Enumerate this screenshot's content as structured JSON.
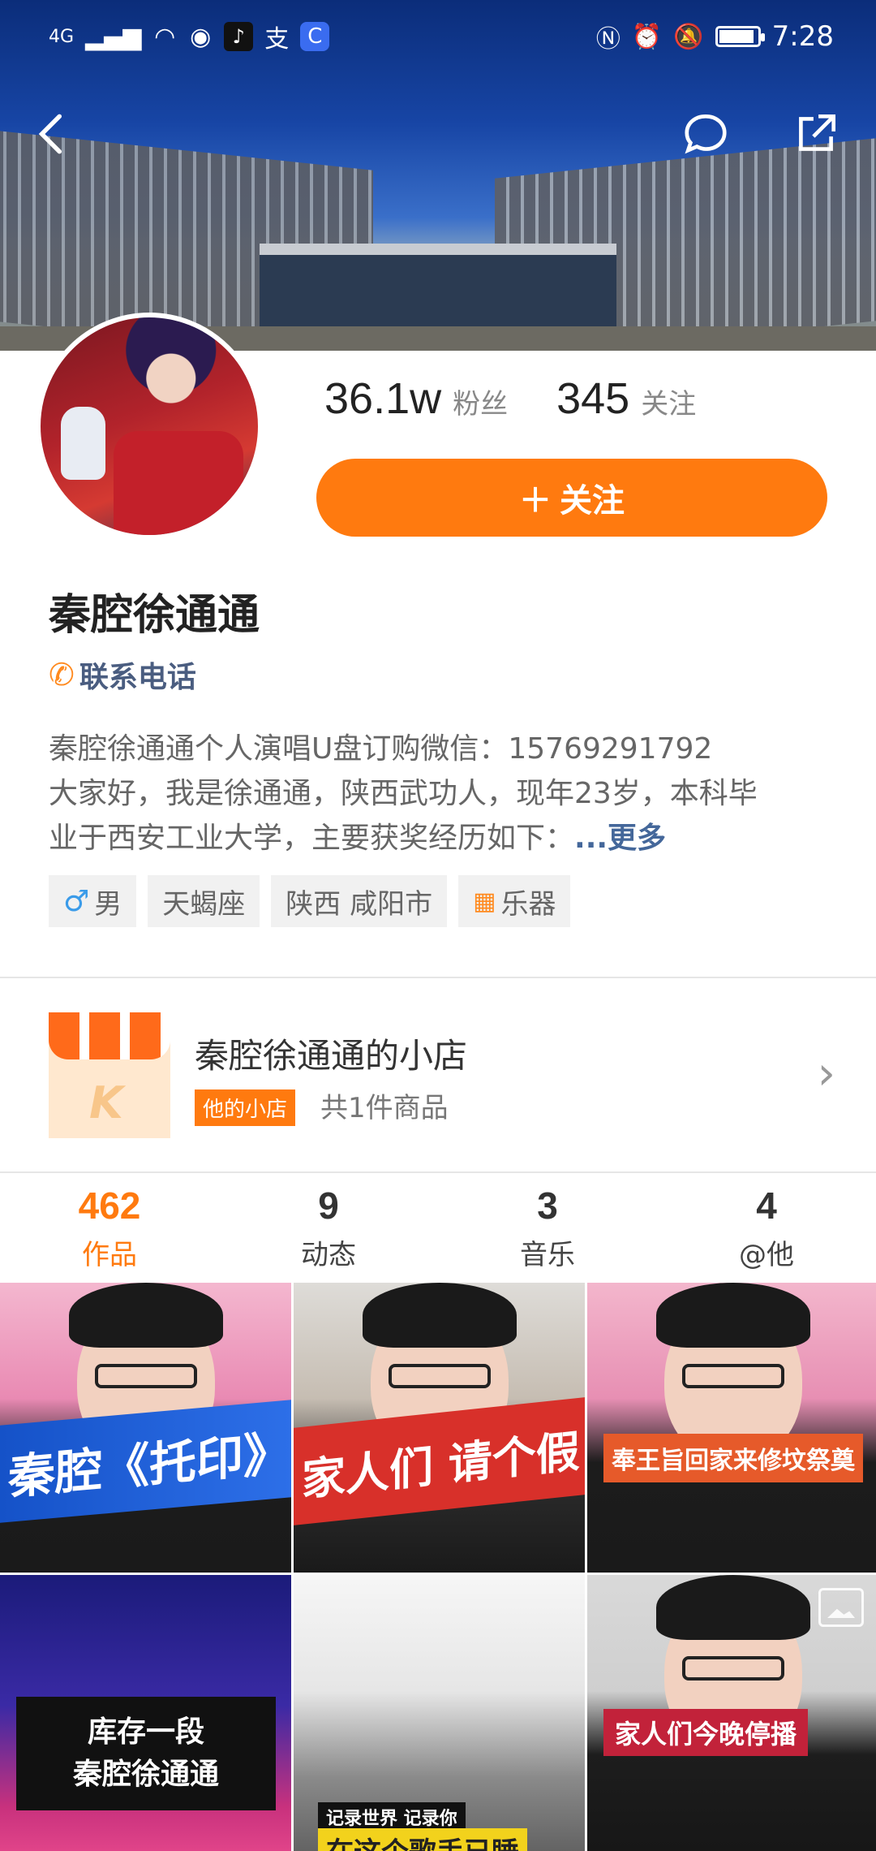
{
  "status_bar": {
    "network": "4G",
    "time": "7:28",
    "battery_level": 0.85
  },
  "profile": {
    "name": "秦腔徐通通",
    "contact_label": "联系电话",
    "followers_value": "36.1w",
    "followers_label": "粉丝",
    "following_value": "345",
    "following_label": "关注",
    "follow_button_label": "关注",
    "bio_line1": "秦腔徐通通个人演唱U盘订购微信：15769291792",
    "bio_line2": "大家好，我是徐通通，陕西武功人，现年23岁，本科毕",
    "bio_line3": "业于西安工业大学，主要获奖经历如下：",
    "bio_more": "...更多",
    "tags": [
      "男",
      "天蝎座",
      "陕西 咸阳市",
      "乐器"
    ]
  },
  "shop": {
    "title": "秦腔徐通通的小店",
    "badge": "他的小店",
    "count": "共1件商品"
  },
  "tabs": [
    {
      "count": "462",
      "label": "作品"
    },
    {
      "count": "9",
      "label": "动态"
    },
    {
      "count": "3",
      "label": "音乐"
    },
    {
      "count": "4",
      "label": "@他"
    }
  ],
  "videos": {
    "v1_caption": "秦腔《托印》",
    "v2_caption": "家人们 请个假",
    "v3_caption": "奉王旨回家来修坟祭奠",
    "v4_caption_line1": "库存一段",
    "v4_caption_line2": "秦腔徐通通",
    "v5_caption_top": "记录世界 记录你",
    "v5_caption_bottom": "在这个歌手已睡",
    "v6_caption": "家人们今晚停播"
  },
  "colors": {
    "accent": "#ff7a0f",
    "link": "#44679a"
  }
}
